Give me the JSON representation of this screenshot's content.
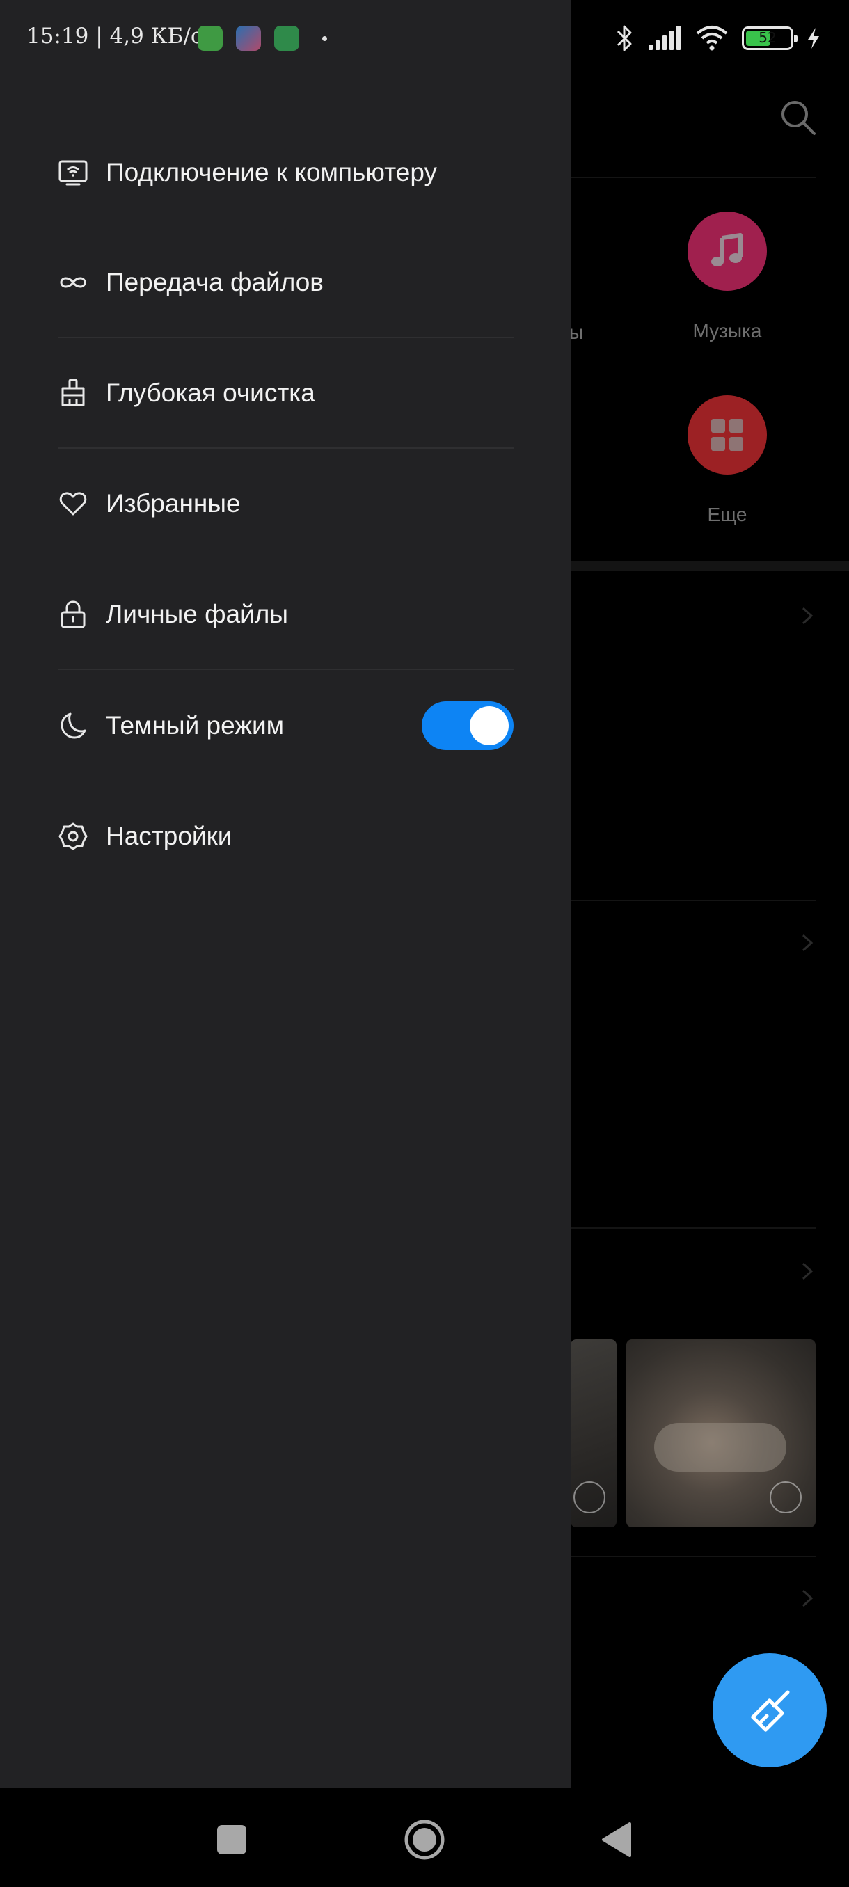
{
  "status_bar": {
    "time_speed": "15:19 | 4,9 КБ/с",
    "battery_level": "52",
    "icons": [
      "bluetooth-icon",
      "signal-icon",
      "wifi-icon",
      "battery-icon",
      "charging-icon"
    ]
  },
  "drawer": {
    "items": [
      {
        "label": "Подключение к компьютеру",
        "icon": "computer-wifi-icon"
      },
      {
        "label": "Передача файлов",
        "icon": "infinity-icon"
      },
      {
        "label": "Глубокая очистка",
        "icon": "broom-icon"
      },
      {
        "label": "Избранные",
        "icon": "heart-icon"
      },
      {
        "label": "Личные файлы",
        "icon": "lock-icon"
      },
      {
        "label": "Темный режим",
        "icon": "moon-icon",
        "toggle_on": true
      },
      {
        "label": "Настройки",
        "icon": "gear-icon"
      }
    ]
  },
  "background": {
    "categories": [
      {
        "label": "Музыка",
        "color": "#a0204e",
        "icon": "music-note-icon"
      },
      {
        "label": "Еще",
        "color": "#9c2124",
        "icon": "grid-icon"
      }
    ],
    "cut_text": "ы"
  },
  "colors": {
    "drawer_bg": "#222224",
    "accent": "#0d84f4",
    "fab": "#2f9af2"
  }
}
